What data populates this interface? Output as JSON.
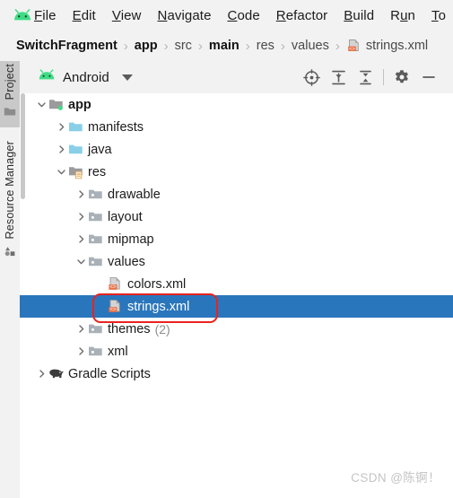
{
  "menu": {
    "logo_icon": "android-logo-icon",
    "items": [
      {
        "label": "File",
        "mnemonic": "F"
      },
      {
        "label": "Edit",
        "mnemonic": "E"
      },
      {
        "label": "View",
        "mnemonic": "V"
      },
      {
        "label": "Navigate",
        "mnemonic": "N"
      },
      {
        "label": "Code",
        "mnemonic": "C"
      },
      {
        "label": "Refactor",
        "mnemonic": "R"
      },
      {
        "label": "Build",
        "mnemonic": "B"
      },
      {
        "label": "Run",
        "mnemonic": "u"
      },
      {
        "label": "To",
        "mnemonic": "T"
      }
    ]
  },
  "breadcrumb": {
    "items": [
      {
        "label": "SwitchFragment",
        "style": "strong",
        "icon": ""
      },
      {
        "label": "app",
        "style": "strong",
        "icon": ""
      },
      {
        "label": "src",
        "style": "dim",
        "icon": ""
      },
      {
        "label": "main",
        "style": "strong",
        "icon": ""
      },
      {
        "label": "res",
        "style": "dim",
        "icon": ""
      },
      {
        "label": "values",
        "style": "dim",
        "icon": ""
      },
      {
        "label": "strings.xml",
        "style": "dim",
        "icon": "xml-file-icon"
      }
    ],
    "separator": "›"
  },
  "toolstrip": {
    "tabs": [
      {
        "label": "Project",
        "icon": "folder-icon",
        "active": true
      },
      {
        "label": "Resource Manager",
        "icon": "shapes-icon",
        "active": false
      }
    ]
  },
  "panel": {
    "title": "Android",
    "title_icon": "android-head-icon",
    "dropdown_icon": "chevron-down-icon",
    "actions": [
      {
        "name": "select-opened-file-button",
        "icon": "crosshair-target-icon"
      },
      {
        "name": "expand-all-button",
        "icon": "expand-all-icon"
      },
      {
        "name": "collapse-all-button",
        "icon": "collapse-all-icon"
      },
      {
        "name": "settings-button",
        "icon": "gear-icon"
      },
      {
        "name": "hide-button",
        "icon": "minimize-dash-icon"
      }
    ]
  },
  "tree": {
    "nodes": [
      {
        "label": "app",
        "count": "",
        "depth": 0,
        "state": "expanded",
        "icon": "module-folder-icon",
        "bold": true,
        "selected": false
      },
      {
        "label": "manifests",
        "count": "",
        "depth": 1,
        "state": "collapsed",
        "icon": "blue-folder-icon",
        "bold": false,
        "selected": false
      },
      {
        "label": "java",
        "count": "",
        "depth": 1,
        "state": "collapsed",
        "icon": "blue-folder-icon",
        "bold": false,
        "selected": false
      },
      {
        "label": "res",
        "count": "",
        "depth": 1,
        "state": "expanded",
        "icon": "res-folder-icon",
        "bold": false,
        "selected": false
      },
      {
        "label": "drawable",
        "count": "",
        "depth": 2,
        "state": "collapsed",
        "icon": "gray-folder-icon",
        "bold": false,
        "selected": false
      },
      {
        "label": "layout",
        "count": "",
        "depth": 2,
        "state": "collapsed",
        "icon": "gray-folder-icon",
        "bold": false,
        "selected": false
      },
      {
        "label": "mipmap",
        "count": "",
        "depth": 2,
        "state": "collapsed",
        "icon": "gray-folder-icon",
        "bold": false,
        "selected": false
      },
      {
        "label": "values",
        "count": "",
        "depth": 2,
        "state": "expanded",
        "icon": "gray-folder-icon",
        "bold": false,
        "selected": false
      },
      {
        "label": "colors.xml",
        "count": "",
        "depth": 3,
        "state": "leaf",
        "icon": "xml-file-icon",
        "bold": false,
        "selected": false
      },
      {
        "label": "strings.xml",
        "count": "",
        "depth": 3,
        "state": "leaf",
        "icon": "xml-file-icon",
        "bold": false,
        "selected": true
      },
      {
        "label": "themes",
        "count": "(2)",
        "depth": 2,
        "state": "collapsed",
        "icon": "gray-folder-icon",
        "bold": false,
        "selected": false
      },
      {
        "label": "xml",
        "count": "",
        "depth": 2,
        "state": "collapsed",
        "icon": "gray-folder-icon",
        "bold": false,
        "selected": false
      },
      {
        "label": "Gradle Scripts",
        "count": "",
        "depth": 0,
        "state": "collapsed",
        "icon": "gradle-elephant-icon",
        "bold": false,
        "selected": false
      }
    ]
  },
  "annotation": {
    "shape": "rounded-rect",
    "color": "#e8231f",
    "target": "strings.xml"
  },
  "watermark": {
    "text": "CSDN @陈锕！"
  },
  "colors": {
    "selection_blue": "#2a76bc",
    "chrome_gray": "#f2f2f2",
    "android_green": "#3ddc84",
    "xml_orange": "#e8734a",
    "annotation_red": "#e8231f"
  }
}
